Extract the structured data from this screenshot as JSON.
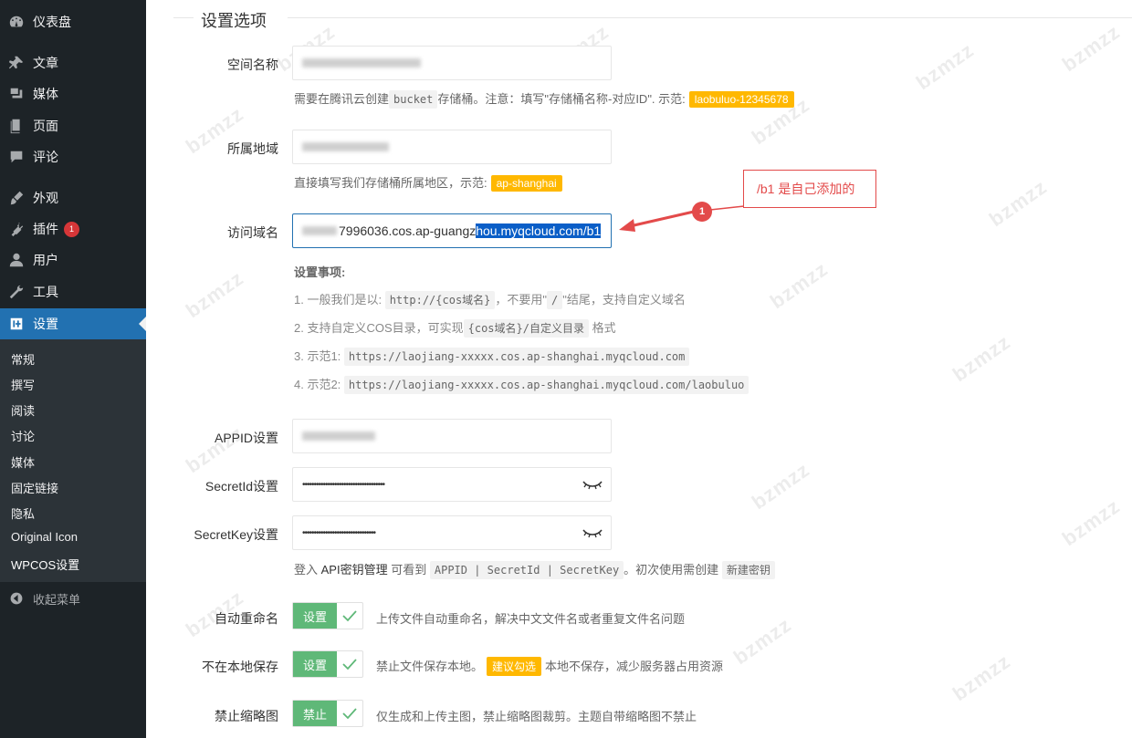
{
  "sidebar": {
    "items": [
      {
        "label": "仪表盘",
        "icon": "dashboard-icon"
      },
      {
        "label": "文章",
        "icon": "pin-icon"
      },
      {
        "label": "媒体",
        "icon": "media-icon"
      },
      {
        "label": "页面",
        "icon": "page-icon"
      },
      {
        "label": "评论",
        "icon": "comment-icon"
      },
      {
        "label": "外观",
        "icon": "brush-icon"
      },
      {
        "label": "插件",
        "icon": "plugin-icon",
        "badge": "1"
      },
      {
        "label": "用户",
        "icon": "user-icon"
      },
      {
        "label": "工具",
        "icon": "wrench-icon"
      },
      {
        "label": "设置",
        "icon": "settings-icon",
        "active": true
      }
    ],
    "submenu": [
      "常规",
      "撰写",
      "阅读",
      "讨论",
      "媒体",
      "固定链接",
      "隐私",
      "Original Icon",
      "WPCOS设置"
    ],
    "collapse_label": "收起菜单"
  },
  "section": {
    "title": "设置选项"
  },
  "fields": {
    "bucket": {
      "label": "空间名称",
      "hint_prefix": "需要在腾讯云创建",
      "hint_code": "bucket",
      "hint_middle": "存储桶。注意：填写\"存储桶名称-对应ID\". 示范:",
      "hint_tag": "laobuluo-12345678"
    },
    "region": {
      "label": "所属地域",
      "hint_prefix": "直接填写我们存储桶所属地区，示范:",
      "hint_tag": "ap-shanghai"
    },
    "domain": {
      "label": "访问域名",
      "value_plain": "7996036.cos.ap-guangz",
      "value_selected": "hou.myqcloud.com/b1"
    },
    "notes": {
      "title": "设置事项:",
      "n1_a": "1. 一般我们是以:",
      "n1_code": "http://{cos域名}",
      "n1_b": "，不要用\"",
      "n1_code2": "/",
      "n1_c": "\"结尾，支持自定义域名",
      "n2_a": "2. 支持自定义COS目录，可实现",
      "n2_code": "{cos域名}/自定义目录",
      "n2_b": "格式",
      "n3_a": "3. 示范1:",
      "n3_code": "https://laojiang-xxxxx.cos.ap-shanghai.myqcloud.com",
      "n4_a": "4. 示范2:",
      "n4_code": "https://laojiang-xxxxx.cos.ap-shanghai.myqcloud.com/laobuluo"
    },
    "appid": {
      "label": "APPID设置"
    },
    "secretid": {
      "label": "SecretId设置",
      "value": "••••••••••••••••••••••••••••••••••••"
    },
    "secretkey": {
      "label": "SecretKey设置",
      "value": "••••••••••••••••••••••••••••••••"
    },
    "key_hint": {
      "prefix": "登入",
      "link": "API密钥管理",
      "middle": "可看到",
      "code": "APPID | SecretId | SecretKey",
      "suffix": "。初次使用需创建",
      "code2": "新建密钥"
    },
    "auto_rename": {
      "label": "自动重命名",
      "switch": "设置",
      "desc": "上传文件自动重命名，解决中文文件名或者重复文件名问题"
    },
    "no_local": {
      "label": "不在本地保存",
      "switch": "设置",
      "desc_a": "禁止文件保存本地。",
      "tag": "建议勾选",
      "desc_b": "本地不保存，减少服务器占用资源"
    },
    "no_thumb": {
      "label": "禁止缩略图",
      "switch": "禁止",
      "desc": "仅生成和上传主图，禁止缩略图裁剪。主题自带缩略图不禁止"
    }
  },
  "annotation": {
    "number": "1",
    "text": "/b1 是自己添加的"
  },
  "watermark": "bzmzz",
  "colors": {
    "sidebar_bg": "#1d2327",
    "active": "#2271b1",
    "tag_yellow": "#ffb800",
    "switch_green": "#5fb878",
    "annotation_red": "#e34a4a"
  }
}
